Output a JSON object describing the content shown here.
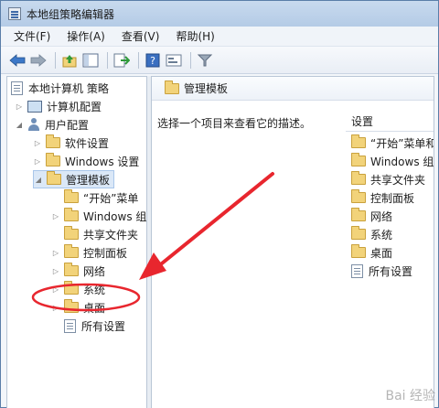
{
  "window": {
    "title": "本地组策略编辑器"
  },
  "menu": {
    "items": [
      "文件(F)",
      "操作(A)",
      "查看(V)",
      "帮助(H)"
    ]
  },
  "toolbar": {
    "icons": [
      "back-arrow-icon",
      "forward-arrow-icon",
      "up-folder-icon",
      "show-hide-tree-icon",
      "export-list-icon",
      "help-icon",
      "properties-icon",
      "filter-icon"
    ]
  },
  "tree": {
    "root": "本地计算机 策略",
    "computer_config": "计算机配置",
    "user_config": "用户配置",
    "software_settings": "软件设置",
    "windows_settings": "Windows 设置",
    "admin_templates": "管理模板",
    "start_menu": "“开始”菜单",
    "windows_components": "Windows 组",
    "shared_folders": "共享文件夹",
    "control_panel": "控制面板",
    "network": "网络",
    "system": "系统",
    "desktop": "桌面",
    "all_settings": "所有设置"
  },
  "right_pane": {
    "header": "管理模板",
    "description": "选择一个项目来查看它的描述。",
    "column_header": "设置",
    "items": [
      "“开始”菜单和任",
      "Windows 组件",
      "共享文件夹",
      "控制面板",
      "网络",
      "系统",
      "桌面",
      "所有设置"
    ]
  },
  "annotation": {
    "color": "#e8262e",
    "highlighted_item": "桌面"
  },
  "watermark": "Bai 经验"
}
